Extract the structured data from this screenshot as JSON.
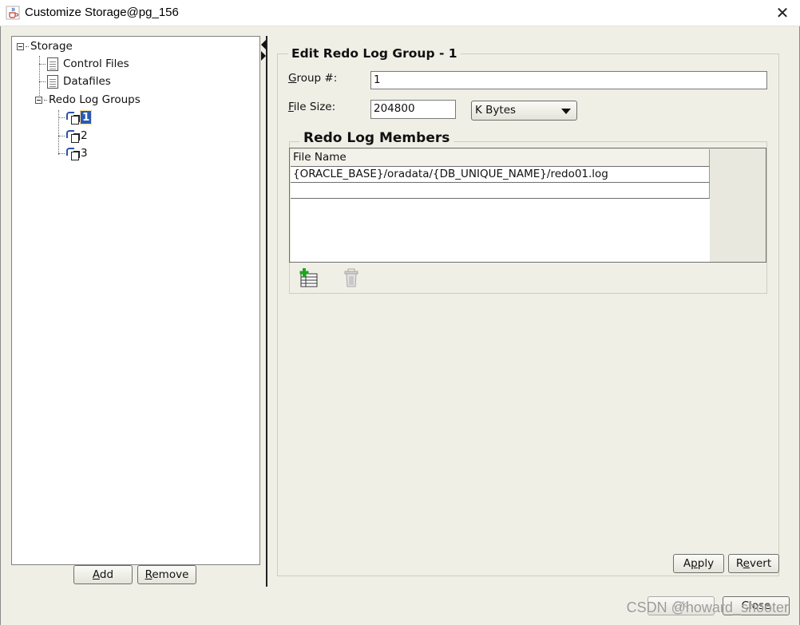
{
  "window": {
    "title": "Customize Storage@pg_156",
    "close_glyph": "✕"
  },
  "tree": {
    "root": "Storage",
    "control_files": "Control Files",
    "datafiles": "Datafiles",
    "redo_log_groups": "Redo Log Groups",
    "groups": [
      "1",
      "2",
      "3"
    ],
    "selected_group": "1"
  },
  "left_buttons": {
    "add": {
      "mnemonic": "A",
      "rest": "dd"
    },
    "remove": {
      "mnemonic": "R",
      "rest": "emove"
    }
  },
  "edit_group": {
    "title": "Edit Redo Log Group - 1",
    "group_label": {
      "mnemonic": "G",
      "rest": "roup #:"
    },
    "group_value": "1",
    "size_label": {
      "mnemonic": "F",
      "rest": "ile Size:"
    },
    "size_value": "204800",
    "size_unit": "K Bytes"
  },
  "members": {
    "title": "Redo Log Members",
    "column": "File Name",
    "rows": [
      "{ORACLE_BASE}/oradata/{DB_UNIQUE_NAME}/redo01.log",
      ""
    ]
  },
  "panel_buttons": {
    "apply": {
      "pre": "A",
      "mnemonic": "p",
      "rest": "ply"
    },
    "revert": {
      "pre": "R",
      "mnemonic": "e",
      "rest": "vert"
    }
  },
  "dialog_buttons": {
    "ok": "OK",
    "close": "Close"
  },
  "icons": {
    "app": "java-cup-icon",
    "add_member": "add-row-icon",
    "delete_member": "trash-icon"
  },
  "watermark": "CSDN @howard_shooter"
}
